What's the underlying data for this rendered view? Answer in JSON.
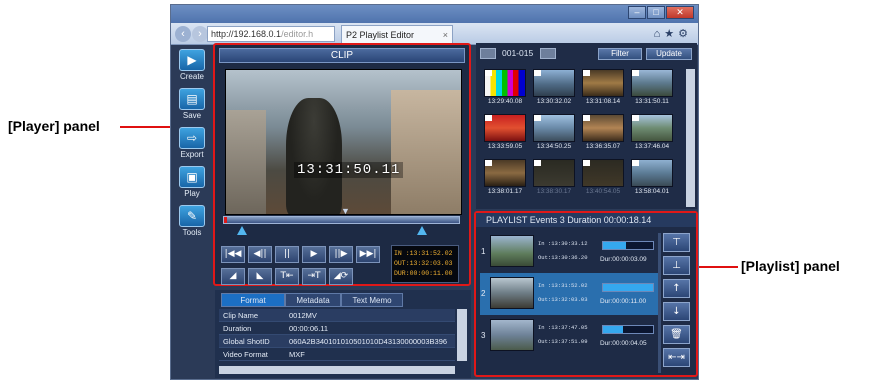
{
  "callouts": {
    "player": "[Player] panel",
    "playlist": "[Playlist] panel"
  },
  "browser": {
    "address_host": "http://192.168.0.1",
    "address_suffix": "/editor.h",
    "tab_title": "P2 Playlist Editor",
    "tab_close": "×",
    "window_controls": [
      "–",
      "□",
      "✕"
    ]
  },
  "toolbar": {
    "items": [
      {
        "label": "Create",
        "icon": "create-icon"
      },
      {
        "label": "Save",
        "icon": "save-icon"
      },
      {
        "label": "Export",
        "icon": "export-icon"
      },
      {
        "label": "Play",
        "icon": "play-icon"
      },
      {
        "label": "Tools",
        "icon": "tools-icon"
      }
    ]
  },
  "player": {
    "title": "CLIP",
    "timecode": "13:31:50.11",
    "in_tc": "IN :13:31:52.02",
    "out_tc": "OUT:13:32:03.03",
    "dur_tc": "DUR:00:00:11.00",
    "transport": [
      "|◀◀",
      "◀||",
      "||",
      "▶",
      "||▶",
      "▶▶|"
    ],
    "edit_buttons": [
      "◢",
      "◣",
      "T⇤",
      "⇥T",
      "◢⟳"
    ]
  },
  "meta": {
    "tabs": [
      "Format",
      "Metadata",
      "Text Memo"
    ],
    "active_tab": "Format",
    "rows": [
      {
        "key": "Clip Name",
        "value": "0012MV"
      },
      {
        "key": "Duration",
        "value": "00:00:06.11"
      },
      {
        "key": "Global ShotID",
        "value": "060A2B340101010501010D43130000003B396"
      },
      {
        "key": "Video Format",
        "value": "MXF"
      }
    ]
  },
  "thumbnails": {
    "range": "001-015",
    "filter_label": "Filter",
    "update_label": "Update",
    "items": [
      {
        "tc": "13:29:40.08"
      },
      {
        "tc": "13:30:32.02"
      },
      {
        "tc": "13:31:08.14"
      },
      {
        "tc": "13:31:50.11"
      },
      {
        "tc": "13:33:59.05"
      },
      {
        "tc": "13:34:50.25"
      },
      {
        "tc": "13:36:35.07"
      },
      {
        "tc": "13:37:46.04"
      },
      {
        "tc": "13:38:01.17"
      },
      {
        "tc": "13:38:30.17"
      },
      {
        "tc": "13:40:54.05"
      },
      {
        "tc": "13:58:04.01"
      }
    ]
  },
  "playlist": {
    "header": "PLAYLIST     Events  3   Duration   00:00:18.14",
    "items": [
      {
        "num": "1",
        "in": "In :13:30:33.12",
        "out": "Out:13:30:36.20",
        "dur": "Dur:00:00:03.09"
      },
      {
        "num": "2",
        "in": "In :13:31:52.02",
        "out": "Out:13:32:03.03",
        "dur": "Dur:00:00:11.00"
      },
      {
        "num": "3",
        "in": "In :13:37:47.05",
        "out": "Out:13:37:51.09",
        "dur": "Dur:00:00:04.05"
      }
    ],
    "side_buttons": [
      "⊤",
      "⊥",
      "↑",
      "↓",
      "🗑",
      "⇤⇥"
    ]
  }
}
